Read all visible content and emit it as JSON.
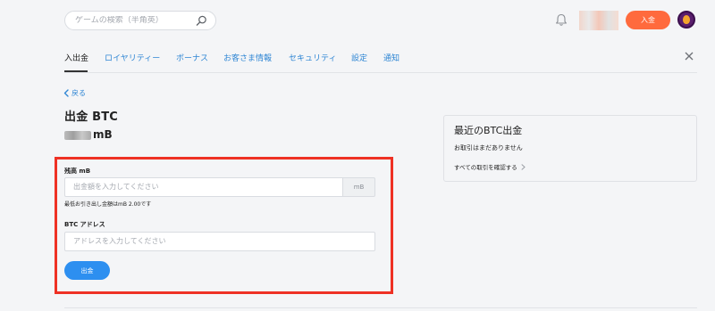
{
  "search": {
    "placeholder": "ゲームの検索（半角英）"
  },
  "header": {
    "deposit_label": "入金"
  },
  "tabs": [
    {
      "label": "入出金"
    },
    {
      "label": "ロイヤリティー"
    },
    {
      "label": "ボーナス"
    },
    {
      "label": "お客さま情報"
    },
    {
      "label": "セキュリティ"
    },
    {
      "label": "設定"
    },
    {
      "label": "通知"
    }
  ],
  "back_label": "戻る",
  "page_title": "出金 BTC",
  "balance_unit": "mB",
  "form": {
    "amount_label": "残高 mB",
    "amount_placeholder": "出金額を入力してください",
    "amount_unit": "mB",
    "min_note": "最低お引き出し金額はmB 2.00です",
    "address_label": "BTC アドレス",
    "address_placeholder": "アドレスを入力してください",
    "submit_label": "出金"
  },
  "recent": {
    "title": "最近のBTC出金",
    "empty_text": "お取引はまだありません",
    "link_label": "すべての取引を確認する"
  },
  "colors": {
    "accent_orange": "#ff6a3d",
    "accent_blue": "#2d8ff0",
    "link_blue": "#2f86d4",
    "highlight_red": "#ee3124"
  }
}
